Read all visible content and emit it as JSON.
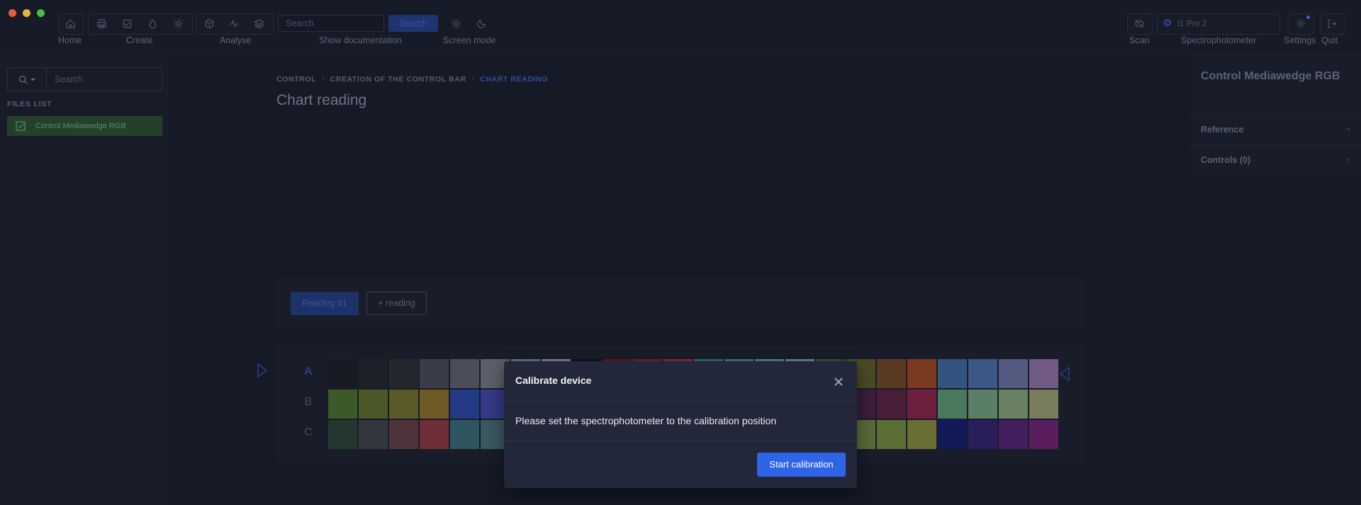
{
  "toolbar": {
    "home_label": "Home",
    "create_label": "Create",
    "analyse_label": "Analyse",
    "search_placeholder": "Search",
    "search_button": "Search",
    "docs_label": "Show documentation",
    "screen_mode_label": "Screen mode",
    "scan_label": "Scan",
    "device_name": "i1 Pro 2",
    "spectro_label": "Spectrophotometer",
    "settings_label": "Settings",
    "quit_label": "Quit"
  },
  "sidebar": {
    "search_placeholder": "Search",
    "files_heading": "FILES LIST",
    "files": [
      {
        "name": "Control Mediawedge RGB"
      }
    ]
  },
  "breadcrumb": {
    "items": [
      "CONTROL",
      "CREATION OF THE CONTROL BAR",
      "CHART READING"
    ],
    "separator": "/"
  },
  "page": {
    "title": "Chart reading"
  },
  "readings": {
    "tab_label": "Reading #1",
    "add_label": "+ reading"
  },
  "chart": {
    "rows": [
      {
        "label": "A",
        "colors": [
          "#171b24",
          "#1d2028",
          "#25272f",
          "#3a3d47",
          "#4b4e58",
          "#5c5f69",
          "#6b6e77",
          "#7b7e86",
          "#0f121b",
          "#5a1a23",
          "#7a1e2a",
          "#8a2432",
          "#2f6a75",
          "#3a7680",
          "#4a808a",
          "#5d8890",
          "#3c4b28",
          "#4a4a24",
          "#5a3a22",
          "#7a3a1f",
          "#33547e",
          "#3d5786",
          "#555a80",
          "#715a84"
        ]
      },
      {
        "label": "B",
        "colors": [
          "#3b5a27",
          "#4a5828",
          "#5a5a27",
          "#6e5a24",
          "#233a84",
          "#343a85",
          "#473a84",
          "#5a3a80",
          "#6c3a7b",
          "#7e3a74",
          "#30526e",
          "#3e5e66",
          "#4e6a5e",
          "#5e7656",
          "#3c5c5e",
          "#4a4a5e",
          "#5a3a5e",
          "#3a1e3a",
          "#4a1e38",
          "#6e1e3e",
          "#4a7a5e",
          "#5a7e66",
          "#6a8062",
          "#7a7c5e"
        ]
      },
      {
        "label": "C",
        "colors": [
          "#23372f",
          "#33363d",
          "#4e343a",
          "#6e2e38",
          "#2e5660",
          "#3a5860",
          "#4a5a60",
          "#5a5c5e",
          "#6a5e5c",
          "#7a605a",
          "#2a4a5a",
          "#3a4e5a",
          "#4a525a",
          "#5a565a",
          "#2a5a4a",
          "#3a5e4a",
          "#4a624a",
          "#5a6a3a",
          "#5a6e36",
          "#6a6e34",
          "#121a5a",
          "#2a1e5a",
          "#421e5e",
          "#5a1e5e"
        ]
      }
    ]
  },
  "right_panel": {
    "title": "Control Mediawedge RGB",
    "sections": [
      {
        "label": "Reference"
      },
      {
        "label": "Controls (0)"
      }
    ]
  },
  "modal": {
    "title": "Calibrate device",
    "message": "Please set the spectrophotometer to the calibration position",
    "button": "Start calibration"
  }
}
